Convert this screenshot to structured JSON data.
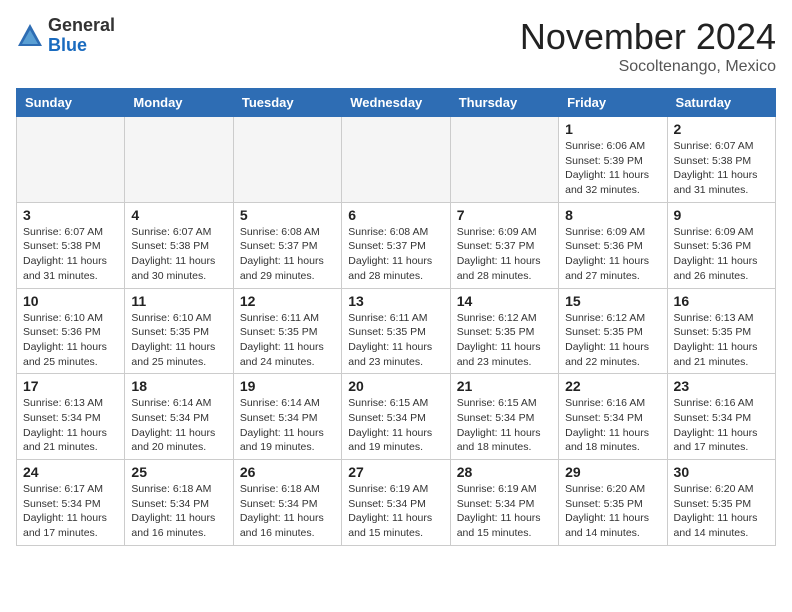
{
  "header": {
    "logo_general": "General",
    "logo_blue": "Blue",
    "month_title": "November 2024",
    "location": "Socoltenango, Mexico"
  },
  "days_of_week": [
    "Sunday",
    "Monday",
    "Tuesday",
    "Wednesday",
    "Thursday",
    "Friday",
    "Saturday"
  ],
  "weeks": [
    [
      {
        "day": "",
        "info": ""
      },
      {
        "day": "",
        "info": ""
      },
      {
        "day": "",
        "info": ""
      },
      {
        "day": "",
        "info": ""
      },
      {
        "day": "",
        "info": ""
      },
      {
        "day": "1",
        "info": "Sunrise: 6:06 AM\nSunset: 5:39 PM\nDaylight: 11 hours\nand 32 minutes."
      },
      {
        "day": "2",
        "info": "Sunrise: 6:07 AM\nSunset: 5:38 PM\nDaylight: 11 hours\nand 31 minutes."
      }
    ],
    [
      {
        "day": "3",
        "info": "Sunrise: 6:07 AM\nSunset: 5:38 PM\nDaylight: 11 hours\nand 31 minutes."
      },
      {
        "day": "4",
        "info": "Sunrise: 6:07 AM\nSunset: 5:38 PM\nDaylight: 11 hours\nand 30 minutes."
      },
      {
        "day": "5",
        "info": "Sunrise: 6:08 AM\nSunset: 5:37 PM\nDaylight: 11 hours\nand 29 minutes."
      },
      {
        "day": "6",
        "info": "Sunrise: 6:08 AM\nSunset: 5:37 PM\nDaylight: 11 hours\nand 28 minutes."
      },
      {
        "day": "7",
        "info": "Sunrise: 6:09 AM\nSunset: 5:37 PM\nDaylight: 11 hours\nand 28 minutes."
      },
      {
        "day": "8",
        "info": "Sunrise: 6:09 AM\nSunset: 5:36 PM\nDaylight: 11 hours\nand 27 minutes."
      },
      {
        "day": "9",
        "info": "Sunrise: 6:09 AM\nSunset: 5:36 PM\nDaylight: 11 hours\nand 26 minutes."
      }
    ],
    [
      {
        "day": "10",
        "info": "Sunrise: 6:10 AM\nSunset: 5:36 PM\nDaylight: 11 hours\nand 25 minutes."
      },
      {
        "day": "11",
        "info": "Sunrise: 6:10 AM\nSunset: 5:35 PM\nDaylight: 11 hours\nand 25 minutes."
      },
      {
        "day": "12",
        "info": "Sunrise: 6:11 AM\nSunset: 5:35 PM\nDaylight: 11 hours\nand 24 minutes."
      },
      {
        "day": "13",
        "info": "Sunrise: 6:11 AM\nSunset: 5:35 PM\nDaylight: 11 hours\nand 23 minutes."
      },
      {
        "day": "14",
        "info": "Sunrise: 6:12 AM\nSunset: 5:35 PM\nDaylight: 11 hours\nand 23 minutes."
      },
      {
        "day": "15",
        "info": "Sunrise: 6:12 AM\nSunset: 5:35 PM\nDaylight: 11 hours\nand 22 minutes."
      },
      {
        "day": "16",
        "info": "Sunrise: 6:13 AM\nSunset: 5:35 PM\nDaylight: 11 hours\nand 21 minutes."
      }
    ],
    [
      {
        "day": "17",
        "info": "Sunrise: 6:13 AM\nSunset: 5:34 PM\nDaylight: 11 hours\nand 21 minutes."
      },
      {
        "day": "18",
        "info": "Sunrise: 6:14 AM\nSunset: 5:34 PM\nDaylight: 11 hours\nand 20 minutes."
      },
      {
        "day": "19",
        "info": "Sunrise: 6:14 AM\nSunset: 5:34 PM\nDaylight: 11 hours\nand 19 minutes."
      },
      {
        "day": "20",
        "info": "Sunrise: 6:15 AM\nSunset: 5:34 PM\nDaylight: 11 hours\nand 19 minutes."
      },
      {
        "day": "21",
        "info": "Sunrise: 6:15 AM\nSunset: 5:34 PM\nDaylight: 11 hours\nand 18 minutes."
      },
      {
        "day": "22",
        "info": "Sunrise: 6:16 AM\nSunset: 5:34 PM\nDaylight: 11 hours\nand 18 minutes."
      },
      {
        "day": "23",
        "info": "Sunrise: 6:16 AM\nSunset: 5:34 PM\nDaylight: 11 hours\nand 17 minutes."
      }
    ],
    [
      {
        "day": "24",
        "info": "Sunrise: 6:17 AM\nSunset: 5:34 PM\nDaylight: 11 hours\nand 17 minutes."
      },
      {
        "day": "25",
        "info": "Sunrise: 6:18 AM\nSunset: 5:34 PM\nDaylight: 11 hours\nand 16 minutes."
      },
      {
        "day": "26",
        "info": "Sunrise: 6:18 AM\nSunset: 5:34 PM\nDaylight: 11 hours\nand 16 minutes."
      },
      {
        "day": "27",
        "info": "Sunrise: 6:19 AM\nSunset: 5:34 PM\nDaylight: 11 hours\nand 15 minutes."
      },
      {
        "day": "28",
        "info": "Sunrise: 6:19 AM\nSunset: 5:34 PM\nDaylight: 11 hours\nand 15 minutes."
      },
      {
        "day": "29",
        "info": "Sunrise: 6:20 AM\nSunset: 5:35 PM\nDaylight: 11 hours\nand 14 minutes."
      },
      {
        "day": "30",
        "info": "Sunrise: 6:20 AM\nSunset: 5:35 PM\nDaylight: 11 hours\nand 14 minutes."
      }
    ]
  ]
}
